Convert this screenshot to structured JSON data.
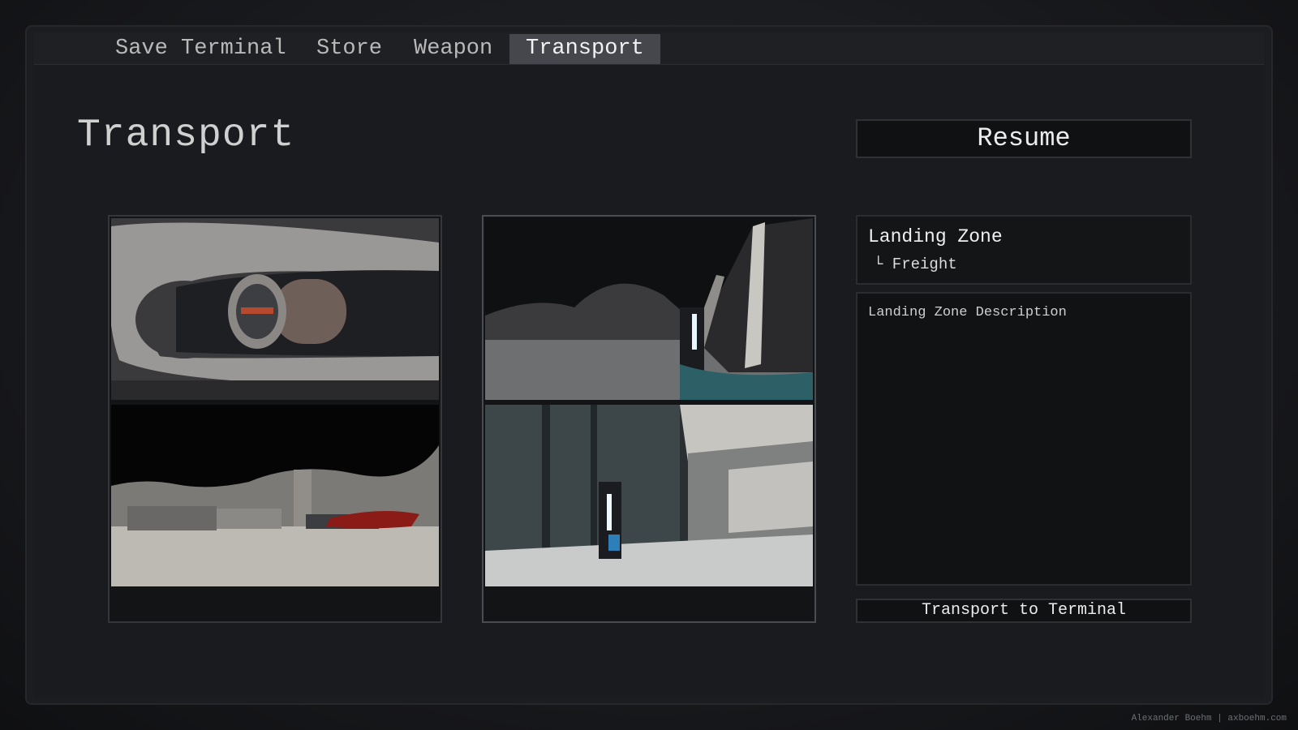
{
  "tabs": [
    {
      "label": "Save Terminal",
      "active": false
    },
    {
      "label": "Store",
      "active": false
    },
    {
      "label": "Weapon",
      "active": false
    },
    {
      "label": "Transport",
      "active": true
    }
  ],
  "page": {
    "title": "Transport"
  },
  "resume_button": "Resume",
  "landing_zone": {
    "name": "Landing Zone",
    "sub_item": "└ Freight"
  },
  "description": "Landing Zone Description",
  "transport_button": "Transport to Terminal",
  "credit": "Alexander Boehm | axboehm.com",
  "colors": {
    "active_tab": "#45474c",
    "background": "#1a1b1e",
    "accent_cyan": "#3fb9d6"
  }
}
